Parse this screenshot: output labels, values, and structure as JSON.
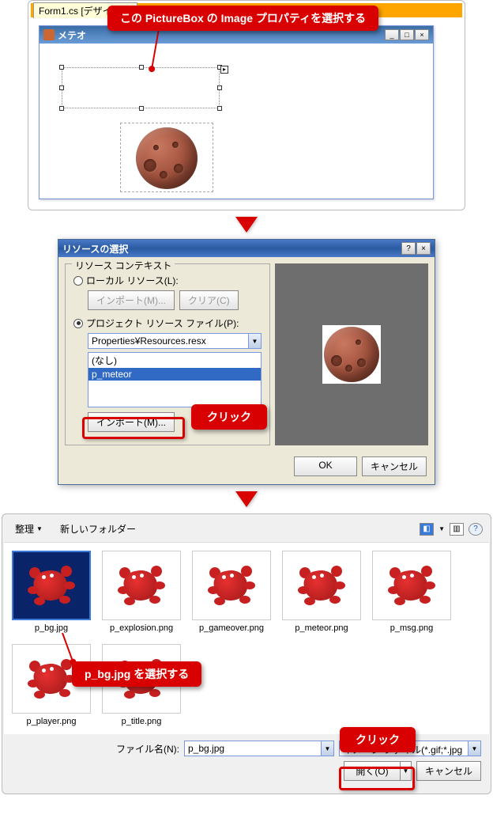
{
  "annotations": {
    "select_property": "この PictureBox の Image プロパティを選択する",
    "click1": "クリック",
    "select_file": "p_bg.jpg  を選択する",
    "click2": "クリック"
  },
  "panel1": {
    "tab_label": "Form1.cs [デザイン]",
    "window_title": "メテオ"
  },
  "panel2": {
    "title": "リソースの選択",
    "fieldset": "リソース コンテキスト",
    "radio_local": "ローカル リソース(L):",
    "btn_import_disabled": "インポート(M)...",
    "btn_clear": "クリア(C)",
    "radio_project": "プロジェクト リソース ファイル(P):",
    "combo_value": "Properties¥Resources.resx",
    "list_none": "(なし)",
    "list_meteor": "p_meteor",
    "btn_import": "インポート(M)...",
    "btn_ok": "OK",
    "btn_cancel": "キャンセル"
  },
  "panel3": {
    "toolbar_organize": "整理",
    "toolbar_newfolder": "新しいフォルダー",
    "files": [
      {
        "name": "p_bg.jpg",
        "selected": true
      },
      {
        "name": "p_explosion.png",
        "selected": false
      },
      {
        "name": "p_gameover.png",
        "selected": false
      },
      {
        "name": "p_meteor.png",
        "selected": false
      },
      {
        "name": "p_msg.png",
        "selected": false
      },
      {
        "name": "p_player.png",
        "selected": false
      },
      {
        "name": "p_title.png",
        "selected": false
      }
    ],
    "label_filename": "ファイル名(N):",
    "input_filename": "p_bg.jpg",
    "filter": "イメージ ファイル(*.gif;*.jpg",
    "btn_open": "開く(O)",
    "btn_cancel": "キャンセル"
  }
}
